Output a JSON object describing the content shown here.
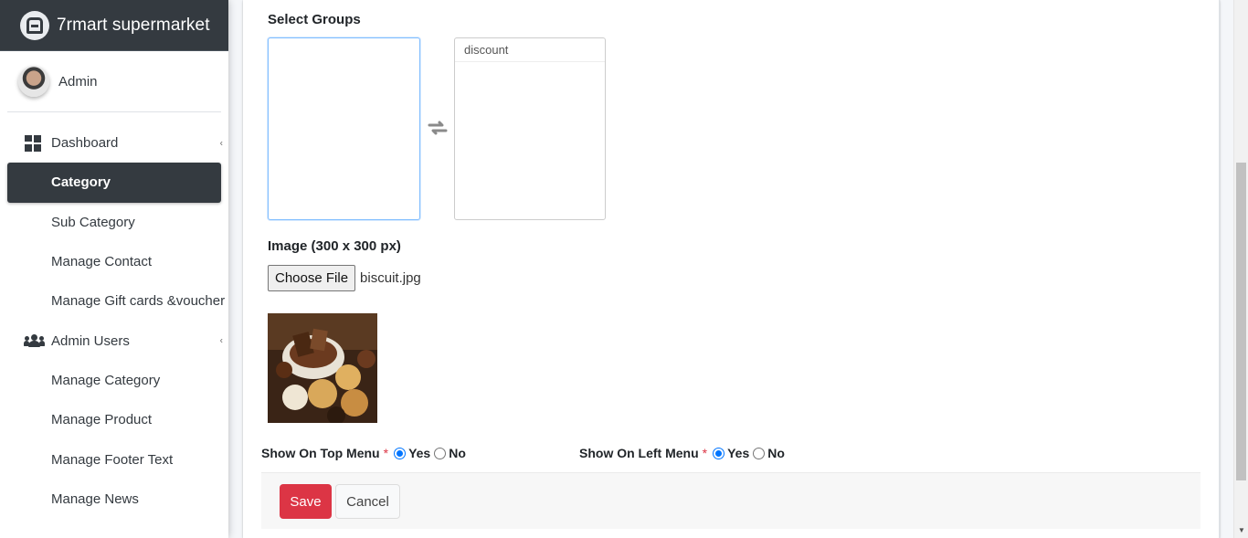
{
  "brand": {
    "name": "7rmart supermarket"
  },
  "user": {
    "name": "Admin"
  },
  "sidebar": {
    "items": [
      {
        "label": "Dashboard",
        "icon": "dashboard-grid-icon",
        "type": "parent"
      },
      {
        "label": "Category",
        "type": "child",
        "active": true
      },
      {
        "label": "Sub Category",
        "type": "child"
      },
      {
        "label": "Manage Contact",
        "type": "child"
      },
      {
        "label": "Manage Gift cards &voucher",
        "type": "child"
      },
      {
        "label": "Admin Users",
        "icon": "users-icon",
        "type": "parent"
      },
      {
        "label": "Manage Category",
        "type": "child"
      },
      {
        "label": "Manage Product",
        "type": "child"
      },
      {
        "label": "Manage Footer Text",
        "type": "child"
      },
      {
        "label": "Manage News",
        "type": "child"
      }
    ]
  },
  "form": {
    "select_groups_label": "Select Groups",
    "selected_groups": [
      "discount"
    ],
    "image_label": "Image (300 x 300 px)",
    "choose_file_label": "Choose File",
    "file_name": "biscuit.jpg",
    "top_menu": {
      "label": "Show On Top Menu",
      "required": "*",
      "yes": "Yes",
      "no": "No",
      "selected": "Yes"
    },
    "left_menu": {
      "label": "Show On Left Menu",
      "required": "*",
      "yes": "Yes",
      "no": "No",
      "selected": "Yes"
    },
    "save_label": "Save",
    "cancel_label": "Cancel"
  },
  "colors": {
    "sidebar_dark": "#343a40",
    "save_button": "#dc3545",
    "radio_accent": "#0075ff"
  }
}
